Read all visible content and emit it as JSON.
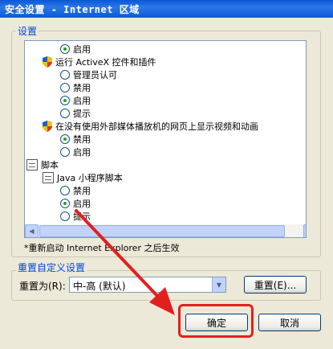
{
  "window": {
    "title": "安全设置 - Internet 区域"
  },
  "settings_group": {
    "legend": "设置"
  },
  "settings_items": [
    {
      "type": "radio",
      "label": "启用",
      "checked": true
    },
    {
      "type": "header",
      "label": "运行 ActiveX 控件和插件",
      "icon": "shield-icon"
    },
    {
      "type": "radio",
      "label": "管理员认可",
      "checked": false
    },
    {
      "type": "radio",
      "label": "禁用",
      "checked": false
    },
    {
      "type": "radio",
      "label": "启用",
      "checked": true
    },
    {
      "type": "radio",
      "label": "提示",
      "checked": false
    },
    {
      "type": "header",
      "label": "在没有使用外部媒体播放机的网页上显示视频和动画",
      "icon": "shield-icon"
    },
    {
      "type": "radio",
      "label": "禁用",
      "checked": true
    },
    {
      "type": "radio",
      "label": "启用",
      "checked": false
    },
    {
      "type": "category",
      "label": "脚本",
      "icon": "script-icon"
    },
    {
      "type": "header",
      "label": "Java 小程序脚本",
      "icon": "script-icon"
    },
    {
      "type": "radio",
      "label": "禁用",
      "checked": false
    },
    {
      "type": "radio",
      "label": "启用",
      "checked": true
    },
    {
      "type": "radio",
      "label": "提示",
      "checked": false
    }
  ],
  "restart_note": "*重新启动 Internet Explorer 之后生效",
  "reset_group": {
    "legend": "重置自定义设置",
    "reset_to_label": "重置为(R):",
    "selected_level": "中-高 (默认)",
    "reset_button": "重置(E)..."
  },
  "footer": {
    "ok_button": "确定",
    "cancel_button": "取消"
  },
  "colors": {
    "title_bar": "#0a58d6",
    "dialog_bg": "#ece9d8",
    "annotation": "#e21f1f"
  }
}
